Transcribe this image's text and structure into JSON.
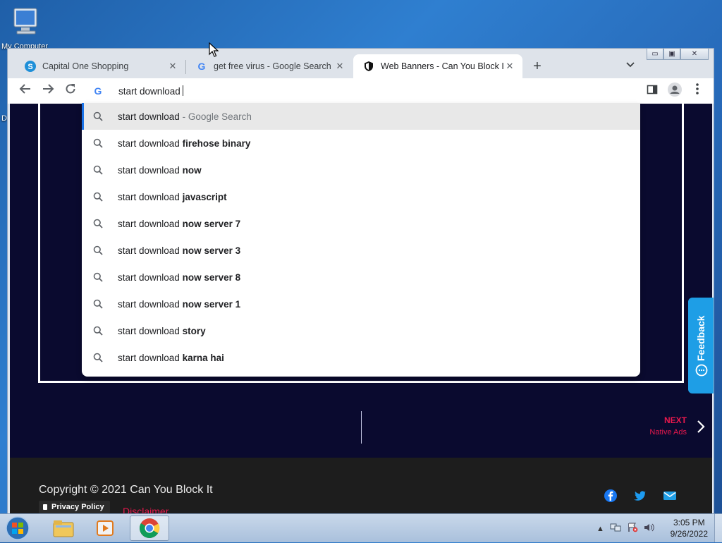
{
  "desktop": {
    "icon_label": "My Computer",
    "partial_label": "D"
  },
  "browser": {
    "tabs": [
      {
        "title": "Capital One Shopping",
        "close": "✕",
        "active": false
      },
      {
        "title": "get free virus - Google Search",
        "close": "✕",
        "active": false
      },
      {
        "title": "Web Banners - Can You Block It ?",
        "close": "✕",
        "active": true
      }
    ],
    "new_tab": "+",
    "omnibox": {
      "value": "start download"
    },
    "suggestions": [
      {
        "prefix": "start download",
        "suffix": "Google Search",
        "type": "search-what-you-typed"
      },
      {
        "prefix": "start download",
        "suffix": "firehose binary"
      },
      {
        "prefix": "start download",
        "suffix": "now"
      },
      {
        "prefix": "start download",
        "suffix": "javascript"
      },
      {
        "prefix": "start download",
        "suffix": "now server 7"
      },
      {
        "prefix": "start download",
        "suffix": "now server 3"
      },
      {
        "prefix": "start download",
        "suffix": "now server 8"
      },
      {
        "prefix": "start download",
        "suffix": "now server 1"
      },
      {
        "prefix": "start download",
        "suffix": "story"
      },
      {
        "prefix": "start download",
        "suffix": "karna hai"
      }
    ]
  },
  "page": {
    "next_label": "NEXT",
    "next_sub": "Native Ads",
    "feedback": "Feedback",
    "footer": {
      "copyright": "Copyright © 2021 Can You Block It",
      "privacy": "Privacy Policy",
      "disclaimer": "Disclaimer"
    },
    "social_icons": [
      "facebook-icon",
      "twitter-icon",
      "mail-icon"
    ]
  },
  "taskbar": {
    "time": "3:05 PM",
    "date": "9/26/2022"
  },
  "colors": {
    "accent_red": "#e8184d",
    "page_bg": "#0a0a2f",
    "feedback_blue": "#1e9ee6",
    "omnibox_highlight": "#1a73e8"
  }
}
